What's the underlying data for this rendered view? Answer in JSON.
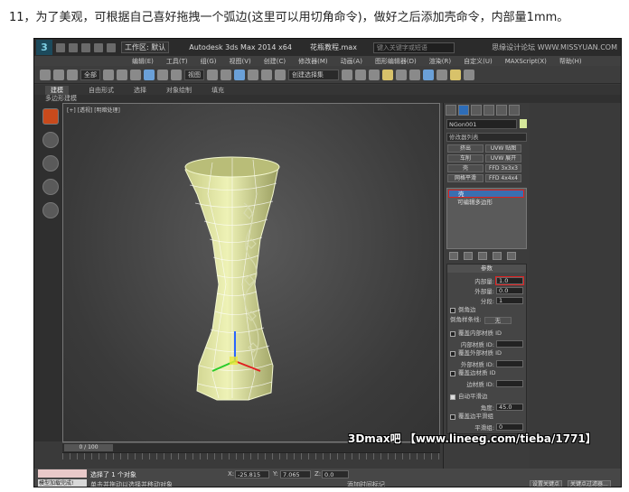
{
  "caption": "11，为了美观，可根据自己喜好拖拽一个弧边(这里可以用切角命令)，做好之后添加壳命令，内部量1mm。",
  "titlebar": {
    "workspace": "工作区: 默认",
    "app_title": "Autodesk 3ds Max  2014 x64",
    "file_name": "花瓶教程.max",
    "search_placeholder": "键入关键字或短语",
    "watermark": "思缘设计论坛 WWW.MISSYUAN.COM"
  },
  "menu": [
    "编辑(E)",
    "工具(T)",
    "组(G)",
    "视图(V)",
    "创建(C)",
    "修改器(M)",
    "动画(A)",
    "图形编辑器(D)",
    "渲染(R)",
    "自定义(U)",
    "MAXScript(X)",
    "帮助(H)"
  ],
  "toolbar": {
    "filter_select": "全部",
    "view_select": "视图",
    "selection_set": "创建选择集"
  },
  "ribbon": {
    "tabs": [
      "建模",
      "自由形式",
      "选择",
      "对象绘制",
      "填充"
    ],
    "active_tab": "建模",
    "panel_label": "多边形建模"
  },
  "viewport": {
    "label": "[+] [透视] [明暗处理]"
  },
  "command_panel": {
    "object_name": "NGon001",
    "modifier_list": "修改器列表",
    "buttons": [
      "挤出",
      "UVW 贴图",
      "车削",
      "UVW 展开",
      "壳",
      "FFD 3x3x3",
      "网格平滑",
      "FFD 4x4x4"
    ],
    "stack": {
      "top_item": "壳",
      "base_item": "可编辑多边形"
    },
    "params": {
      "header": "参数",
      "inner_label": "内部量:",
      "inner_value": "1.0",
      "outer_label": "外部量:",
      "outer_value": "0.0",
      "segments_label": "分段:",
      "segments_value": "1",
      "bevel_edges": "倒角边",
      "bevel_spline_label": "倒角样条线:",
      "bevel_spline_value": "无",
      "override_inner_mat": "覆盖内部材质 ID",
      "inner_mat_label": "内部材质 ID:",
      "override_outer_mat": "覆盖外部材质 ID",
      "outer_mat_label": "外部材质 ID:",
      "override_edge_mat": "覆盖边材质 ID",
      "edge_mat_label": "边材质 ID:",
      "auto_smooth": "自动平滑边",
      "angle_label": "角度:",
      "angle_value": "45.0",
      "override_smooth": "覆盖边平滑组",
      "smooth_group_label": "平滑组:",
      "smooth_group_value": "0"
    }
  },
  "timeline": {
    "frame": "0 / 100"
  },
  "status": {
    "left_top": "",
    "left_bottom": "模型加载完成!",
    "selected": "选择了 1 个对象",
    "hint": "单击并拖动以选择并移动对象",
    "x_label": "X:",
    "x_value": "-25.815",
    "y_label": "Y:",
    "y_value": "7.065",
    "z_label": "Z:",
    "z_value": "0.0",
    "add_tag": "添加时间标记",
    "set_key": "设置关键点",
    "key_filter": "关键点过滤器..."
  },
  "overlay_watermark": "3Dmax吧 【www.lineeg.com/tieba/1771】"
}
